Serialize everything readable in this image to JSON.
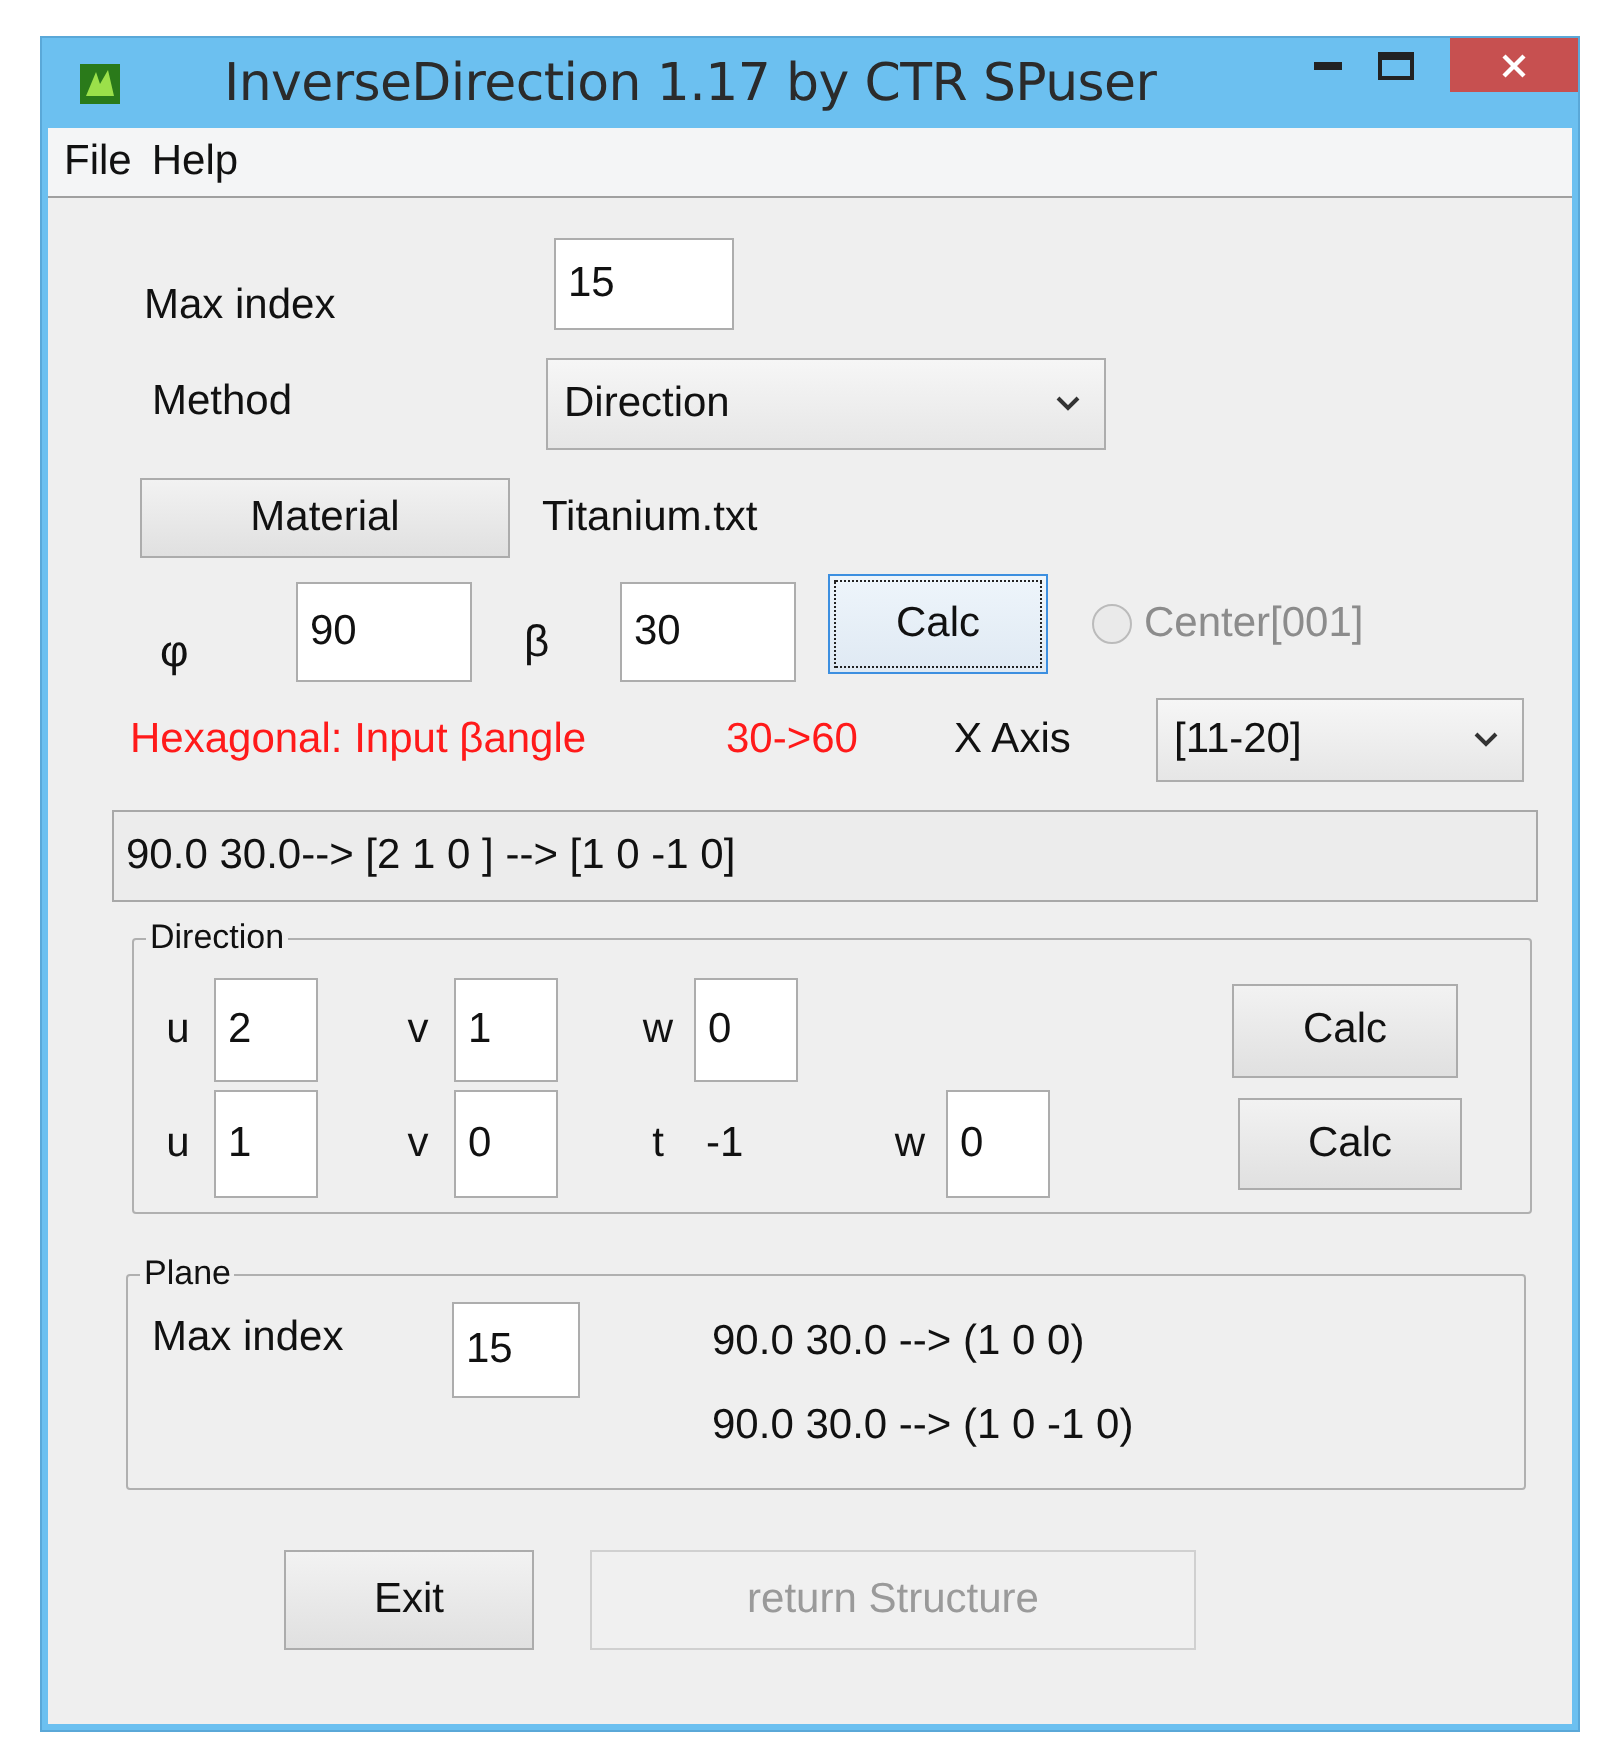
{
  "window": {
    "title": "InverseDirection 1.17 by CTR SPuser"
  },
  "menu": [
    "File",
    "Help"
  ],
  "max_index": {
    "label": "Max index",
    "value": "15"
  },
  "method": {
    "label": "Method",
    "value": "Direction"
  },
  "material": {
    "button": "Material",
    "file": "Titanium.txt"
  },
  "angles": {
    "phi_label": "φ",
    "phi": "90",
    "beta_label": "β",
    "beta": "30",
    "calc": "Calc",
    "calc_focused": true,
    "center": {
      "label": "Center[001]",
      "checked": false,
      "disabled": true
    }
  },
  "warning": {
    "message": "Hexagonal: Input βangle",
    "change": "30->60"
  },
  "x_axis": {
    "label": "X Axis",
    "value": "[11-20]"
  },
  "result": "90.0 30.0--> [2 1 0 ] --> [1 0 -1 0]",
  "direction": {
    "title": "Direction",
    "three_index": {
      "fields": [
        {
          "label": "u",
          "value": "2"
        },
        {
          "label": "v",
          "value": "1"
        },
        {
          "label": "w",
          "value": "0"
        }
      ],
      "calc": "Calc"
    },
    "four_index": {
      "fields": [
        {
          "label": "u",
          "value": "1"
        },
        {
          "label": "v",
          "value": "0"
        },
        {
          "label": "t",
          "value": "-1",
          "kind": "text"
        },
        {
          "label": "w",
          "value": "0"
        }
      ],
      "calc": "Calc"
    }
  },
  "plane": {
    "title": "Plane",
    "label": "Max index",
    "value": "15",
    "results": [
      "90.0 30.0 --> (1 0 0)",
      "90.0 30.0 --> (1 0 -1 0)"
    ]
  },
  "buttons": [
    {
      "label": "Exit",
      "disabled": false
    },
    {
      "label": "return Structure",
      "disabled": true
    }
  ]
}
